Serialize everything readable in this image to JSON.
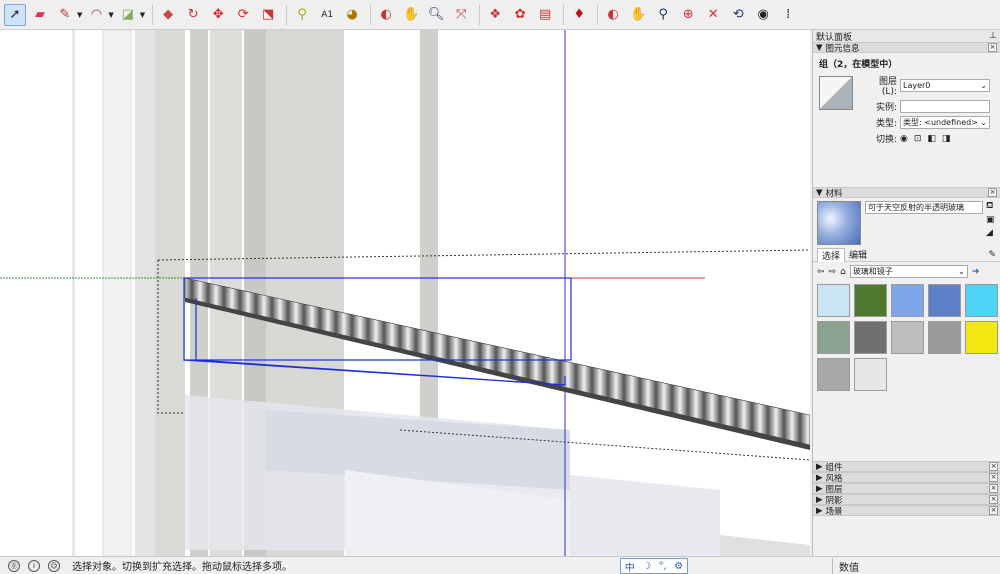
{
  "toolbar": {
    "tools": [
      "select-icon",
      "eraser-icon",
      "pencil-icon",
      "arc-icon",
      "rectangle-icon",
      "push-pull-icon",
      "follow-me-icon",
      "move-icon",
      "rotate-icon",
      "scale-icon",
      "tape-measure-icon",
      "text-icon",
      "paint-bucket-icon",
      "orbit-icon",
      "pan-icon",
      "zoom-icon",
      "zoom-extents-icon",
      "components-icon",
      "materials-icon",
      "styles-icon",
      "ruby-icon",
      "orbit2-icon",
      "pan2-icon",
      "zoom2-icon",
      "zoom-window-icon",
      "zoom-extents2-icon",
      "previous-icon",
      "look-around-icon",
      "walk-icon"
    ]
  },
  "panel": {
    "title": "默认面板",
    "entity_info": {
      "header": "图元信息",
      "title": "组（2，在模型中）",
      "layer_label": "图层(L):",
      "layer_value": "Layer0",
      "instance_label": "实例:",
      "instance_value": "",
      "type_label": "类型:",
      "type_value": "类型: <undefined>",
      "toggle_label": "切换:"
    },
    "materials": {
      "header": "材料",
      "material_name": "可于天空反射的半透明玻璃",
      "tab_select": "选择",
      "tab_edit": "编辑",
      "library": "玻璃和镜子",
      "swatch_colors": [
        "#c9e4f2",
        "#4d7a2e",
        "#7fa6e8",
        "#5d7fc7",
        "#4fd3f5",
        "#8aa38f",
        "#707070",
        "#bdbdbd",
        "#9a9a9a",
        "#f0e810",
        "#a8a8a8",
        "#e6e6e6"
      ]
    },
    "collapsed": [
      "组件",
      "风格",
      "图层",
      "阴影",
      "场景"
    ]
  },
  "statusbar": {
    "message": "选择对象。切换到扩充选择。拖动鼠标选择多项。",
    "ime": [
      "中",
      "☽",
      "°,",
      "⚙"
    ],
    "value_label": "数值"
  }
}
